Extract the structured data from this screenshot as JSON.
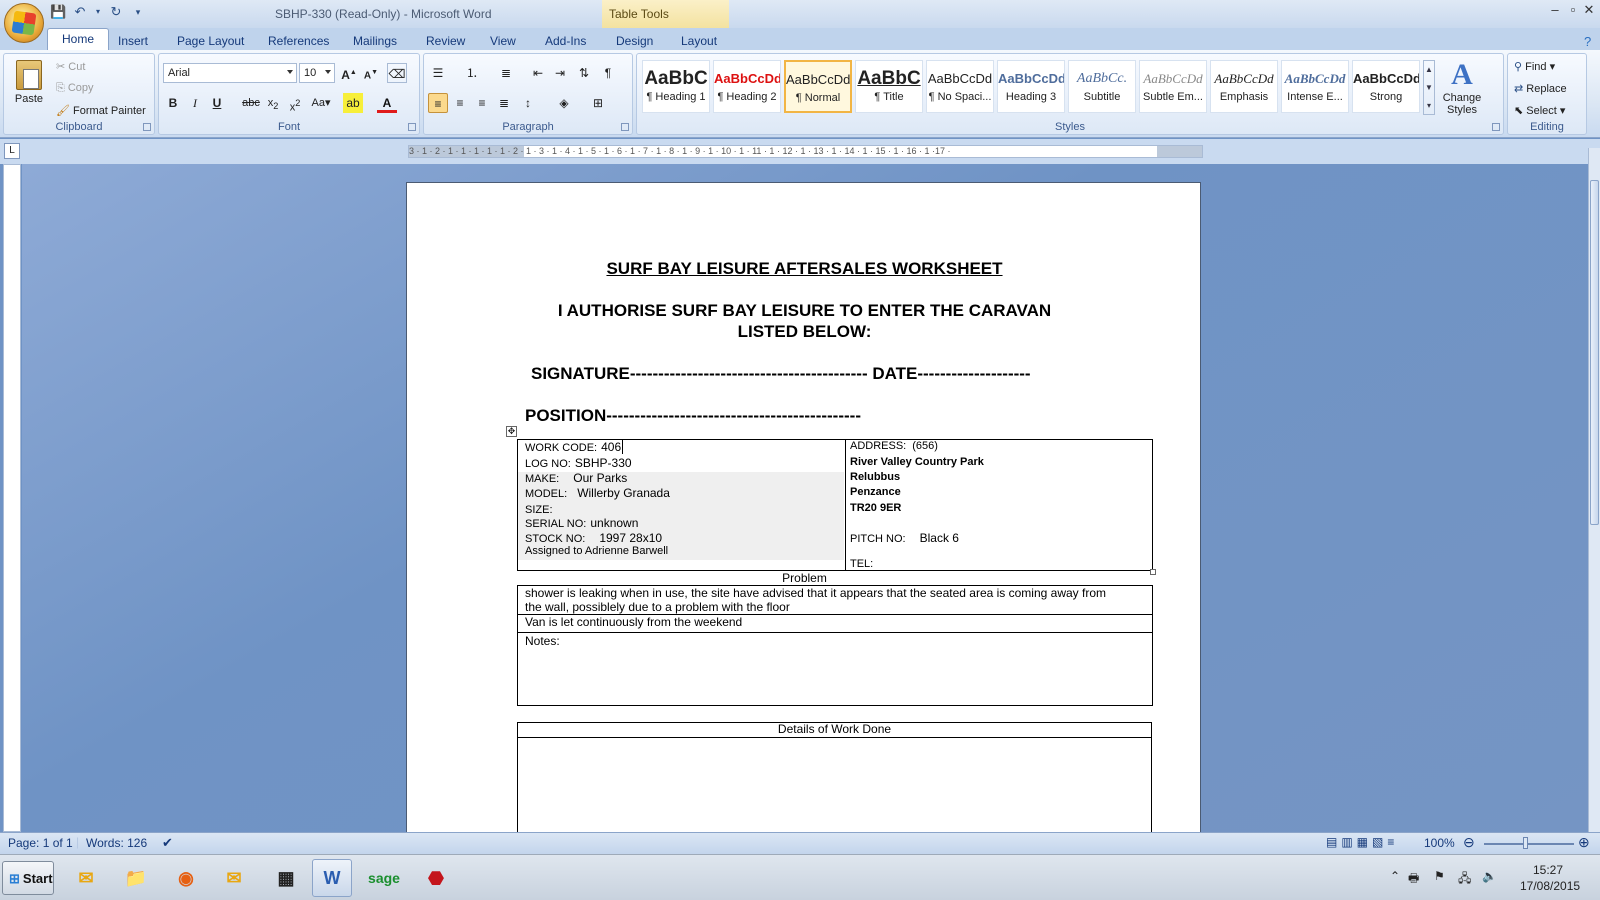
{
  "window": {
    "title": "SBHP-330 (Read-Only) - Microsoft Word",
    "context_tab_group": "Table Tools",
    "controls": [
      "–",
      "▫",
      "✕"
    ]
  },
  "tabs": [
    "Home",
    "Insert",
    "Page Layout",
    "References",
    "Mailings",
    "Review",
    "View",
    "Add-Ins",
    "Design",
    "Layout"
  ],
  "ribbon": {
    "clipboard": {
      "paste": "Paste",
      "cut": "Cut",
      "copy": "Copy",
      "format_painter": "Format Painter",
      "label": "Clipboard"
    },
    "font": {
      "name": "Arial",
      "size": "10",
      "label": "Font"
    },
    "paragraph": {
      "label": "Paragraph"
    },
    "styles": {
      "label": "Styles",
      "items": [
        {
          "sample": "AaBbC",
          "name": "¶ Heading 1"
        },
        {
          "sample": "AaBbCcDd",
          "name": "¶ Heading 2"
        },
        {
          "sample": "AaBbCcDd",
          "name": "¶ Normal"
        },
        {
          "sample": "AaBbC",
          "name": "¶ Title"
        },
        {
          "sample": "AaBbCcDd",
          "name": "¶ No Spaci..."
        },
        {
          "sample": "AaBbCcDd",
          "name": "Heading 3"
        },
        {
          "sample": "AaBbCc.",
          "name": "Subtitle"
        },
        {
          "sample": "AaBbCcDd",
          "name": "Subtle Em..."
        },
        {
          "sample": "AaBbCcDd",
          "name": "Emphasis"
        },
        {
          "sample": "AaBbCcDd",
          "name": "Intense E..."
        },
        {
          "sample": "AaBbCcDd",
          "name": "Strong"
        }
      ],
      "change_styles": "Change Styles"
    },
    "editing": {
      "find": "Find",
      "replace": "Replace",
      "select": "Select",
      "label": "Editing"
    }
  },
  "ruler": {
    "labels": "3 · 1 · 2 · 1 · 1 · 1 · 1 · 1 · 2 · 1 · 3 · 1 · 4 · 1 · 5 · 1 · 6 · 1 · 7 · 1 · 8 · 1 · 9 · 1 · 10 · 1 · 11 · 1 · 12 · 1 · 13 · 1 · 14 · 1 · 15 · 1 · 16 · 1 ·17 ·"
  },
  "document": {
    "title": "SURF BAY LEISURE AFTERSALES WORKSHEET",
    "authorise_line1": "I AUTHORISE SURF BAY LEISURE TO ENTER THE CARAVAN",
    "authorise_line2": "LISTED BELOW:",
    "signature_line": "SIGNATURE------------------------------------------ DATE--------------------",
    "position_line": "POSITION---------------------------------------------",
    "left": {
      "work_code_label": "WORK CODE:",
      "work_code": "406",
      "log_no_label": "LOG NO:",
      "log_no": "SBHP-330",
      "make_label": "MAKE:",
      "make": "Our Parks",
      "model_label": "MODEL:",
      "model": "Willerby Granada",
      "size_label": "SIZE:",
      "size": "",
      "serial_label": "SERIAL NO:",
      "serial": "unknown",
      "stock_label": "STOCK NO:",
      "stock": "1997 28x10",
      "assigned": "Assigned to Adrienne Barwell"
    },
    "right": {
      "address_label": "ADDRESS:",
      "address_code": "(656)",
      "address_lines": [
        "River Valley Country Park",
        "Relubbus",
        "Penzance",
        "TR20 9ER"
      ],
      "pitch_label": "PITCH NO:",
      "pitch": "Black 6",
      "tel_label": "TEL:"
    },
    "problem_heading": "Problem",
    "problem_text1": "shower is leaking when in use, the site have advised that it appears that the seated area is coming away from",
    "problem_text2": "the wall, possiblely due to a problem with the floor",
    "problem_text3": "Van is let continuously from the weekend",
    "notes_label": "Notes:",
    "details_heading": "Details of Work Done"
  },
  "statusbar": {
    "page": "Page: 1 of 1",
    "words": "Words: 126",
    "zoom": "100%"
  },
  "taskbar": {
    "start": "Start",
    "time": "15:27",
    "date": "17/08/2015"
  }
}
